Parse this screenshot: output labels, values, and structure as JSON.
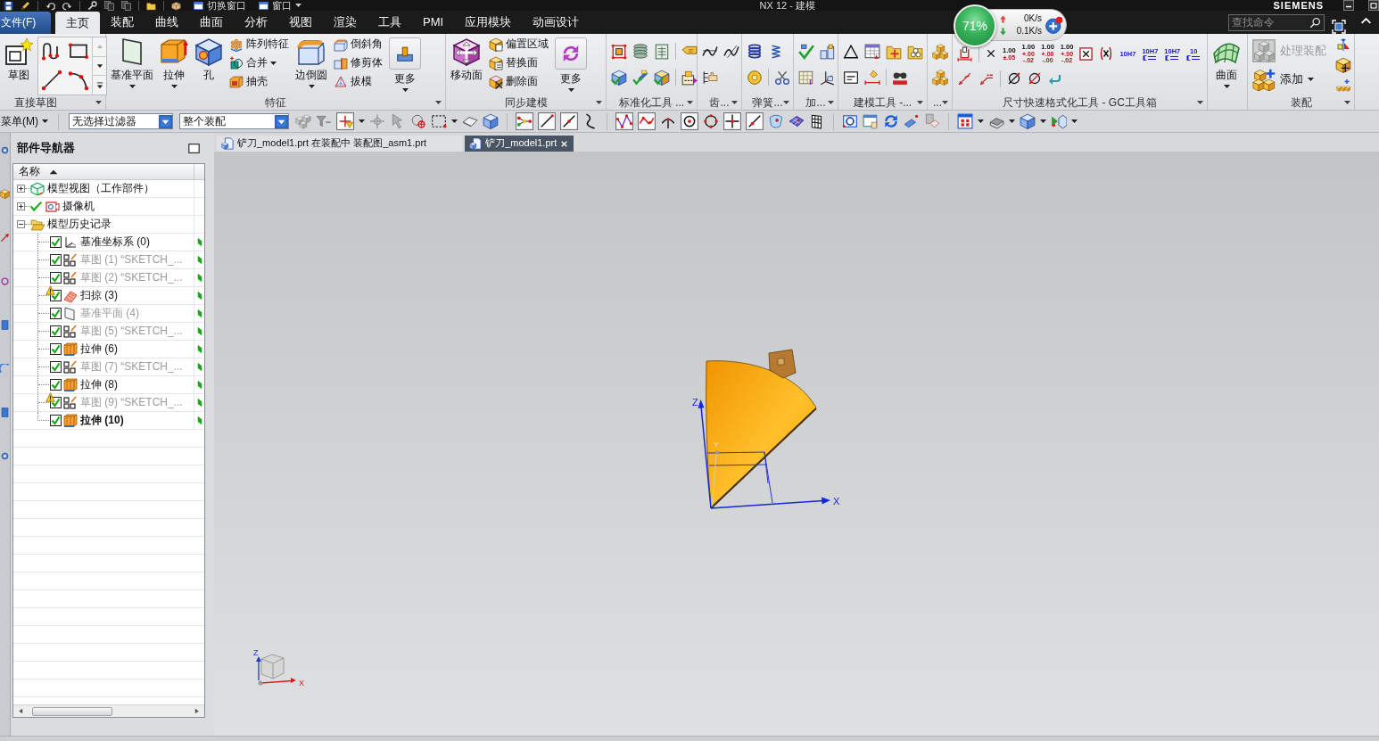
{
  "title_bar": {
    "window_buttons": [
      {
        "label": "切换窗口",
        "dropdown": false
      },
      {
        "label": "窗口",
        "dropdown": true
      }
    ],
    "title": "NX 12 - 建模",
    "brand": "SIEMENS"
  },
  "file_menu": {
    "label": "文件(F)"
  },
  "ribbon_tabs": [
    {
      "label": "主页",
      "selected": true
    },
    {
      "label": "装配",
      "selected": false
    },
    {
      "label": "曲线",
      "selected": false
    },
    {
      "label": "曲面",
      "selected": false
    },
    {
      "label": "分析",
      "selected": false
    },
    {
      "label": "视图",
      "selected": false
    },
    {
      "label": "渲染",
      "selected": false
    },
    {
      "label": "工具",
      "selected": false
    },
    {
      "label": "PMI",
      "selected": false
    },
    {
      "label": "应用模块",
      "selected": false
    },
    {
      "label": "动画设计",
      "selected": false
    }
  ],
  "command_search": {
    "placeholder": "查找命令"
  },
  "network_monitor": {
    "usage": "71%",
    "upload": "0K/s",
    "download": "0.1K/s"
  },
  "ribbon_groups": [
    {
      "label": "直接草图",
      "launcher": true,
      "items": [
        {
          "kind": "large",
          "label": "草图",
          "dropdown": false
        }
      ]
    },
    {
      "label": "特征",
      "launcher": true,
      "items": [
        {
          "kind": "large",
          "label": "基准平面",
          "dropdown": true
        },
        {
          "kind": "large",
          "label": "拉伸",
          "dropdown": true
        },
        {
          "kind": "large",
          "label": "孔",
          "dropdown": false
        },
        {
          "kind": "stack",
          "buttons": [
            {
              "label": "阵列特征",
              "dropdown": false
            },
            {
              "label": "合并",
              "dropdown": true
            },
            {
              "label": "抽壳",
              "dropdown": false
            }
          ]
        },
        {
          "kind": "large",
          "label": "边倒圆",
          "dropdown": true
        },
        {
          "kind": "stack",
          "buttons": [
            {
              "label": "倒斜角",
              "dropdown": false
            },
            {
              "label": "修剪体",
              "dropdown": false
            },
            {
              "label": "拔模",
              "dropdown": false
            }
          ]
        },
        {
          "kind": "more",
          "label": "更多",
          "dropdown": true
        }
      ]
    },
    {
      "label": "同步建模",
      "launcher": true,
      "items": [
        {
          "kind": "large",
          "label": "移动面",
          "dropdown": false
        },
        {
          "kind": "stack",
          "buttons": [
            {
              "label": "偏置区域",
              "dropdown": false
            },
            {
              "label": "替换面",
              "dropdown": false
            },
            {
              "label": "删除面",
              "dropdown": false
            }
          ]
        },
        {
          "kind": "more",
          "label": "更多",
          "dropdown": true
        }
      ]
    },
    {
      "label": "标准化工具 ...",
      "launcher": true
    },
    {
      "label": "齿...",
      "launcher": true
    },
    {
      "label": "弹簧...",
      "launcher": true
    },
    {
      "label": "加...",
      "launcher": true
    },
    {
      "label": "建模工具 -...",
      "launcher": true
    },
    {
      "label": "...",
      "launcher": true
    },
    {
      "label": "尺寸快速格式化工具 - GC工具箱",
      "launcher": true,
      "items": [
        {
          "kind": "tolerance_tools",
          "tolerances": [
            {
              "nominal": "1.00",
              "limits": [
                "±.05"
              ]
            },
            {
              "nominal": "1.00",
              "limits": [
                "+.00",
                "-.02"
              ]
            },
            {
              "nominal": "1.00",
              "limits": [
                "+.00",
                "-.00"
              ]
            },
            {
              "nominal": "1.00",
              "limits": [
                "+.00",
                "-.02"
              ]
            }
          ],
          "fit_codes": [
            {
              "code": "10H7",
              "bracket": false
            },
            {
              "code": "10H7",
              "bracket": true
            },
            {
              "code": "10H7",
              "bracket": true
            },
            {
              "code": "10",
              "bracket": true
            }
          ]
        }
      ]
    },
    {
      "launcher": false,
      "items": [
        {
          "kind": "large",
          "label": "曲面",
          "dropdown": true
        }
      ]
    },
    {
      "label": "装配",
      "launcher": true,
      "items": [
        {
          "kind": "wide_stack",
          "buttons": [
            {
              "label": "处理装配",
              "disabled": true,
              "dropdown": false
            },
            {
              "label": "添加",
              "disabled": false,
              "dropdown": true
            }
          ]
        }
      ]
    }
  ],
  "selection_bar": {
    "menu": "菜单(M)",
    "type_filter": "无选择过滤器",
    "scope_filter": "整个装配"
  },
  "part_navigator": {
    "title": "部件导航器",
    "columns": [
      {
        "label": "名称",
        "sort_ascending": true
      }
    ],
    "tree": [
      {
        "label": "模型视图（工作部件）",
        "kind": "views",
        "expanded": false,
        "checked": false
      },
      {
        "label": "摄像机",
        "kind": "camera",
        "expanded": false,
        "checked": true
      },
      {
        "label": "模型历史记录",
        "kind": "history",
        "expanded": true,
        "checked": false,
        "children": [
          {
            "label": "基准坐标系 (0)",
            "kind": "csys",
            "checked": true,
            "dimmed": false,
            "warning": false,
            "current": false
          },
          {
            "label": "草图 (1) “SKETCH_...",
            "kind": "sketch",
            "checked": true,
            "dimmed": true,
            "warning": false,
            "current": false
          },
          {
            "label": "草图 (2) “SKETCH_...",
            "kind": "sketch",
            "checked": true,
            "dimmed": true,
            "warning": false,
            "current": false
          },
          {
            "label": "扫掠 (3)",
            "kind": "sweep",
            "checked": true,
            "dimmed": false,
            "warning": true,
            "current": false
          },
          {
            "label": "基准平面 (4)",
            "kind": "plane",
            "checked": true,
            "dimmed": true,
            "warning": false,
            "current": false
          },
          {
            "label": "草图 (5) “SKETCH_...",
            "kind": "sketch",
            "checked": true,
            "dimmed": true,
            "warning": false,
            "current": false
          },
          {
            "label": "拉伸 (6)",
            "kind": "extrude",
            "checked": true,
            "dimmed": false,
            "warning": false,
            "current": false
          },
          {
            "label": "草图 (7) “SKETCH_...",
            "kind": "sketch",
            "checked": true,
            "dimmed": true,
            "warning": false,
            "current": false
          },
          {
            "label": "拉伸 (8)",
            "kind": "extrude",
            "checked": true,
            "dimmed": false,
            "warning": false,
            "current": false
          },
          {
            "label": "草图 (9) “SKETCH_...",
            "kind": "sketch",
            "checked": true,
            "dimmed": true,
            "warning": true,
            "current": false
          },
          {
            "label": "拉伸 (10)",
            "kind": "extrude",
            "checked": true,
            "dimmed": false,
            "warning": false,
            "current": true
          }
        ]
      }
    ]
  },
  "doc_tabs": [
    {
      "label": "铲刀_model1.prt 在装配中 装配图_asm1.prt",
      "selected": false,
      "closable": false
    },
    {
      "label": "铲刀_model1.prt",
      "selected": true,
      "closable": true
    }
  ],
  "viewport": {
    "model_axes": [
      {
        "label": "Z"
      },
      {
        "label": "Y"
      },
      {
        "label": "X"
      }
    ],
    "view_triad": [
      {
        "label": "Z"
      },
      {
        "label": "X"
      }
    ]
  }
}
